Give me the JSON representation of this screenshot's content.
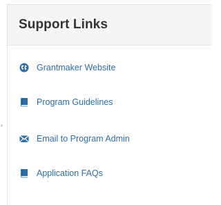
{
  "panel": {
    "title": "Support Links"
  },
  "links": [
    {
      "label": "Grantmaker Website",
      "icon": "globe-icon"
    },
    {
      "label": "Program Guidelines",
      "icon": "book-icon"
    },
    {
      "label": "Email to Program Admin",
      "icon": "envelope-icon"
    },
    {
      "label": "Application FAQs",
      "icon": "book-icon"
    }
  ],
  "colors": {
    "link": "#2e6da4",
    "icon": "#2e6da4",
    "header_bg": "#f5f5f5",
    "title": "#333333"
  }
}
